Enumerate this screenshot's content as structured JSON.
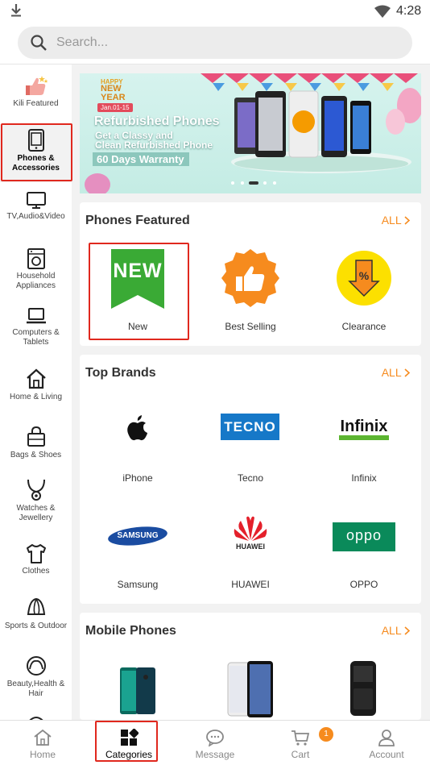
{
  "status_bar": {
    "time": "4:28"
  },
  "search": {
    "placeholder": "Search..."
  },
  "sidebar": {
    "items": [
      {
        "label": "Kili Featured",
        "icon": "thumbs-up-stars-icon"
      },
      {
        "label": "Phones & Accessories",
        "icon": "phone-icon",
        "active": true
      },
      {
        "label": "TV,Audio&Video",
        "icon": "tv-icon"
      },
      {
        "label": "Household Appliances",
        "icon": "washing-machine-icon"
      },
      {
        "label": "Computers & Tablets",
        "icon": "laptop-icon"
      },
      {
        "label": "Home & Living",
        "icon": "home-icon"
      },
      {
        "label": "Bags & Shoes",
        "icon": "bag-icon"
      },
      {
        "label": "Watches & Jewellery",
        "icon": "necklace-icon"
      },
      {
        "label": "Clothes",
        "icon": "shirt-icon"
      },
      {
        "label": "Sports & Outdoor",
        "icon": "ball-icon"
      },
      {
        "label": "Beauty,Health & Hair",
        "icon": "face-icon"
      }
    ]
  },
  "banner": {
    "happy": "HAPPY",
    "new_year": "NEW YEAR",
    "dates": "Jan.01-15",
    "title": "Refurbished Phones",
    "subtitle_1": "Get a Classy and",
    "subtitle_2": "Clean Refurbished Phone",
    "warranty": "60 Days Warranty",
    "active_dot": 3,
    "dot_count": 5
  },
  "phones_featured": {
    "title": "Phones Featured",
    "all": "ALL",
    "new_badge": "NEW",
    "items": [
      {
        "label": "New",
        "icon": "new-ribbon-icon"
      },
      {
        "label": "Best Selling",
        "icon": "thumbs-up-badge-icon"
      },
      {
        "label": "Clearance",
        "icon": "percent-down-icon"
      }
    ]
  },
  "top_brands": {
    "title": "Top Brands",
    "all": "ALL",
    "items": [
      {
        "label": "iPhone",
        "logo": "apple-logo"
      },
      {
        "label": "Tecno",
        "logo": "tecno-logo",
        "logo_text": "TECNO"
      },
      {
        "label": "Infinix",
        "logo": "infinix-logo",
        "logo_text": "Infinix"
      },
      {
        "label": "Samsung",
        "logo": "samsung-logo",
        "logo_text": "SAMSUNG"
      },
      {
        "label": "HUAWEI",
        "logo": "huawei-logo",
        "logo_text": "HUAWEI"
      },
      {
        "label": "OPPO",
        "logo": "oppo-logo",
        "logo_text": "oppo"
      }
    ]
  },
  "mobile_phones": {
    "title": "Mobile Phones",
    "all": "ALL"
  },
  "bottom_nav": {
    "items": [
      {
        "label": "Home",
        "icon": "home-icon"
      },
      {
        "label": "Categories",
        "icon": "categories-icon",
        "active": true
      },
      {
        "label": "Message",
        "icon": "chat-icon"
      },
      {
        "label": "Cart",
        "icon": "cart-icon"
      },
      {
        "label": "Account",
        "icon": "account-icon"
      }
    ],
    "cart_badge": "1"
  },
  "colors": {
    "accent": "#f68b1e",
    "highlight_border": "#e0281e",
    "new_green": "#3aaa35"
  }
}
